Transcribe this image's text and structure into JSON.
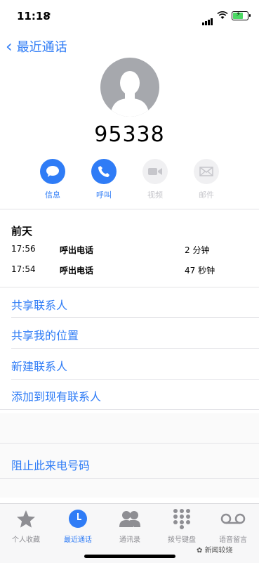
{
  "status": {
    "time": "11:18"
  },
  "header": {
    "back_label": "最近通话"
  },
  "contact": {
    "number": "95338"
  },
  "actions": [
    {
      "label": "信息",
      "enabled": true
    },
    {
      "label": "呼叫",
      "enabled": true
    },
    {
      "label": "视频",
      "enabled": false
    },
    {
      "label": "邮件",
      "enabled": false
    }
  ],
  "calls": {
    "day": "前天",
    "rows": [
      {
        "time": "17:56",
        "type": "呼出电话",
        "duration": "2 分钟"
      },
      {
        "time": "17:54",
        "type": "呼出电话",
        "duration": "47 秒钟"
      }
    ]
  },
  "links": {
    "share_contact": "共享联系人",
    "share_location": "共享我的位置",
    "new_contact": "新建联系人",
    "add_existing": "添加到现有联系人",
    "block": "阻止此来电号码"
  },
  "tabs": [
    {
      "label": "个人收藏",
      "icon": "star-icon"
    },
    {
      "label": "最近通话",
      "icon": "clock-icon",
      "active": true
    },
    {
      "label": "通讯录",
      "icon": "contacts-icon"
    },
    {
      "label": "拨号键盘",
      "icon": "keypad-icon"
    },
    {
      "label": "语音留言",
      "icon": "voicemail-icon"
    }
  ],
  "watermark": "新闻较烧",
  "colors": {
    "accent": "#2f7cf6",
    "inactive": "#8e8e93",
    "disabled": "#c6c6cb"
  }
}
